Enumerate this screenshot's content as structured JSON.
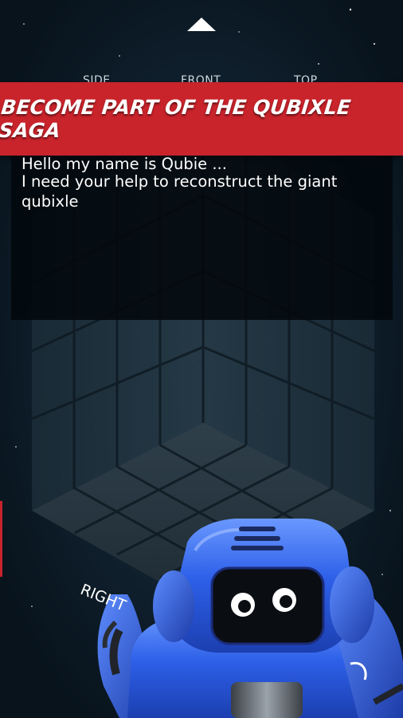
{
  "navigation": {
    "up_arrow_icon": "triangle-up-icon",
    "views": [
      {
        "label": "SIDE"
      },
      {
        "label": "FRONT"
      },
      {
        "label": "TOP"
      }
    ]
  },
  "banner": {
    "text": "Become part of the Qubixle Saga",
    "color": "#c9232b"
  },
  "dialog": {
    "lines": [
      "Hello my name is Qubie ...",
      "I need your help to reconstruct the giant",
      "qubixle"
    ]
  },
  "controls": {
    "rotate_label": "RIGHT"
  },
  "character": {
    "name": "Qubie",
    "body_color": "#2d5fe8"
  }
}
